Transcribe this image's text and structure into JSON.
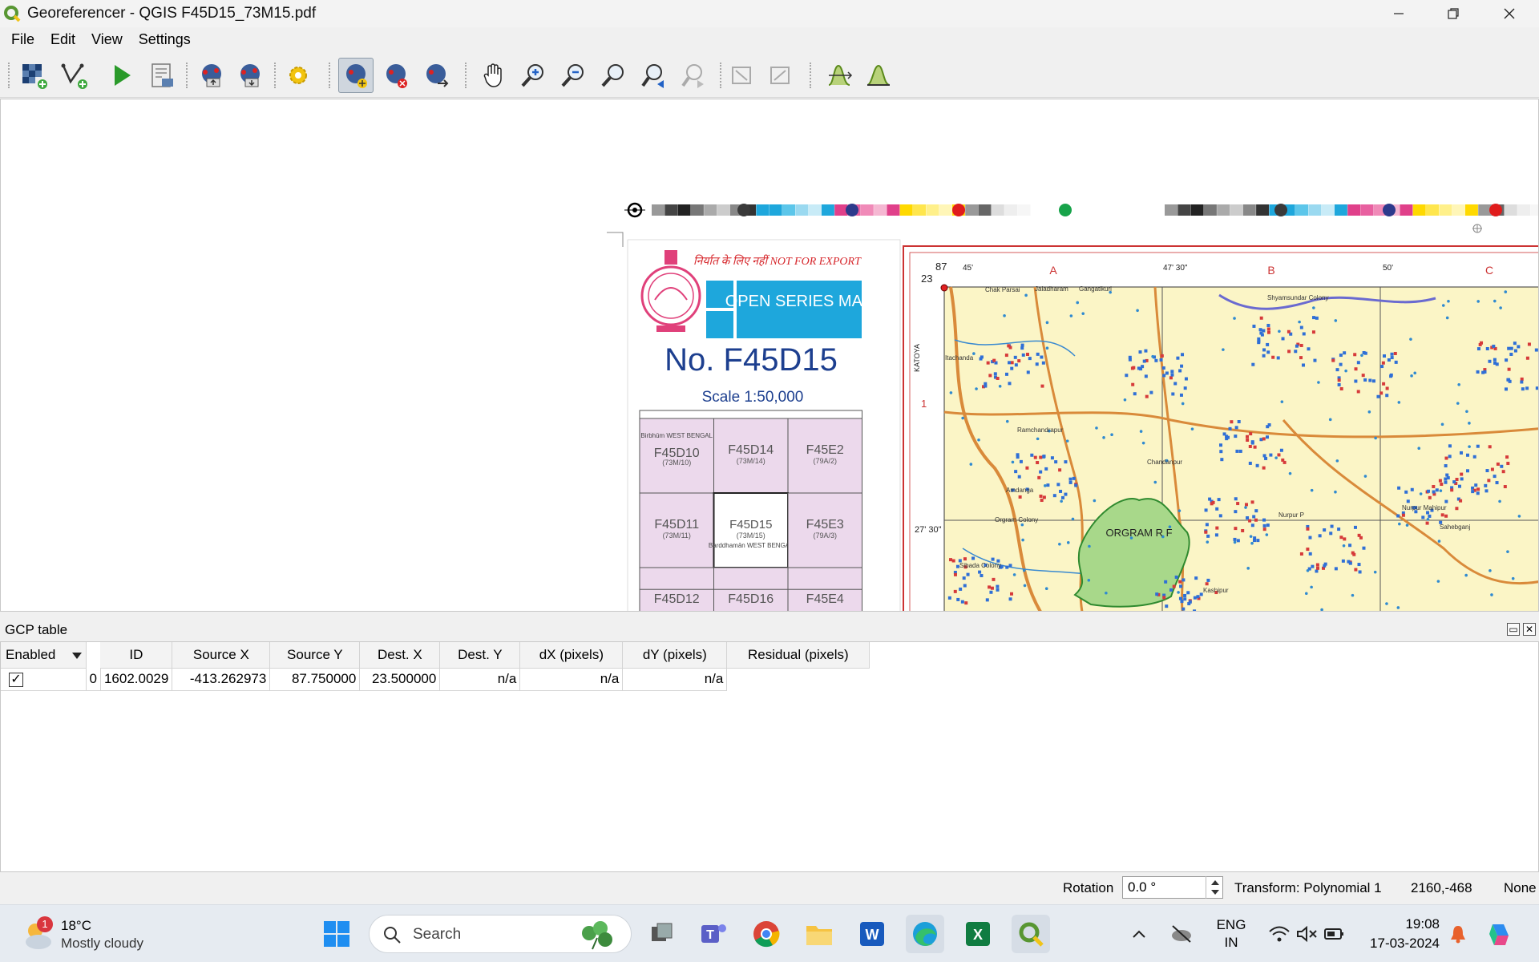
{
  "window": {
    "title": "Georeferencer - QGIS F45D15_73M15.pdf"
  },
  "menu": [
    "File",
    "Edit",
    "View",
    "Settings"
  ],
  "map": {
    "export_text": "निर्यात के लिए नहीं NOT FOR EXPORT",
    "series_text": "OPEN SERIES MAP",
    "sheet_number": "No.  F45D15",
    "scale": "Scale   1:50,000",
    "index_sheets": [
      {
        "code": "F45D10",
        "sub": "(73M/10)",
        "note": "Birbhūm WEST BENGAL"
      },
      {
        "code": "F45D14",
        "sub": "(73M/14)",
        "note": ""
      },
      {
        "code": "F45E2",
        "sub": "(79A/2)",
        "note": ""
      },
      {
        "code": "F45D11",
        "sub": "(73M/11)",
        "note": ""
      },
      {
        "code": "F45D15",
        "sub": "(73M/15)",
        "note": "Barddhamān WEST BENGAL"
      },
      {
        "code": "F45E3",
        "sub": "(79A/3)",
        "note": ""
      },
      {
        "code": "F45D12",
        "sub": "",
        "note": ""
      },
      {
        "code": "F45D16",
        "sub": "",
        "note": ""
      },
      {
        "code": "F45E4",
        "sub": "",
        "note": ""
      }
    ],
    "grid_letters": [
      "A",
      "B",
      "C"
    ],
    "row_number": "1",
    "lat_label": "23",
    "lon_label": "87",
    "lon_ticks": [
      "45'",
      "47' 30\"",
      "50'"
    ],
    "lat_tick": "27' 30\"",
    "katoya": "KATOYA",
    "forest_label": "ORGRAM R F",
    "place_names": [
      "Chak Parsai",
      "Jaladharam",
      "Gangatikuri",
      "Shyamsundar Colony",
      "Itachanda",
      "Ramchandrapur",
      "Chandanpur",
      "Amdanga",
      "Orgram Colony",
      "Nurpur Mahipur",
      "Nurpur P",
      "Sahebganj",
      "Kashipur",
      "Sibada Colony"
    ]
  },
  "gcp": {
    "title": "GCP table",
    "columns": [
      "Enabled",
      "ID",
      "Source X",
      "Source Y",
      "Dest. X",
      "Dest. Y",
      "dX (pixels)",
      "dY (pixels)",
      "Residual (pixels)"
    ],
    "rows": [
      {
        "enabled": "✓",
        "id": "0",
        "source_x": "1602.0029",
        "source_y": "-413.262973",
        "dest_x": "87.750000",
        "dest_y": "23.500000",
        "dx": "n/a",
        "dy": "n/a",
        "residual": "n/a"
      }
    ]
  },
  "status": {
    "rotation_label": "Rotation",
    "rotation_value": "0.0 °",
    "transform": "Transform: Polynomial 1",
    "coords": "2160,-468",
    "crs": "None"
  },
  "taskbar": {
    "weather_temp": "18°C",
    "weather_desc": "Mostly cloudy",
    "weather_badge": "1",
    "search_placeholder": "Search",
    "lang_top": "ENG",
    "lang_bottom": "IN",
    "time": "19:08",
    "date": "17-03-2024"
  },
  "colors": {
    "accent": "#1ea7dc",
    "qgis_green": "#589632",
    "map_paper": "#fbf5c6",
    "index_pink": "#ecd9ec"
  }
}
